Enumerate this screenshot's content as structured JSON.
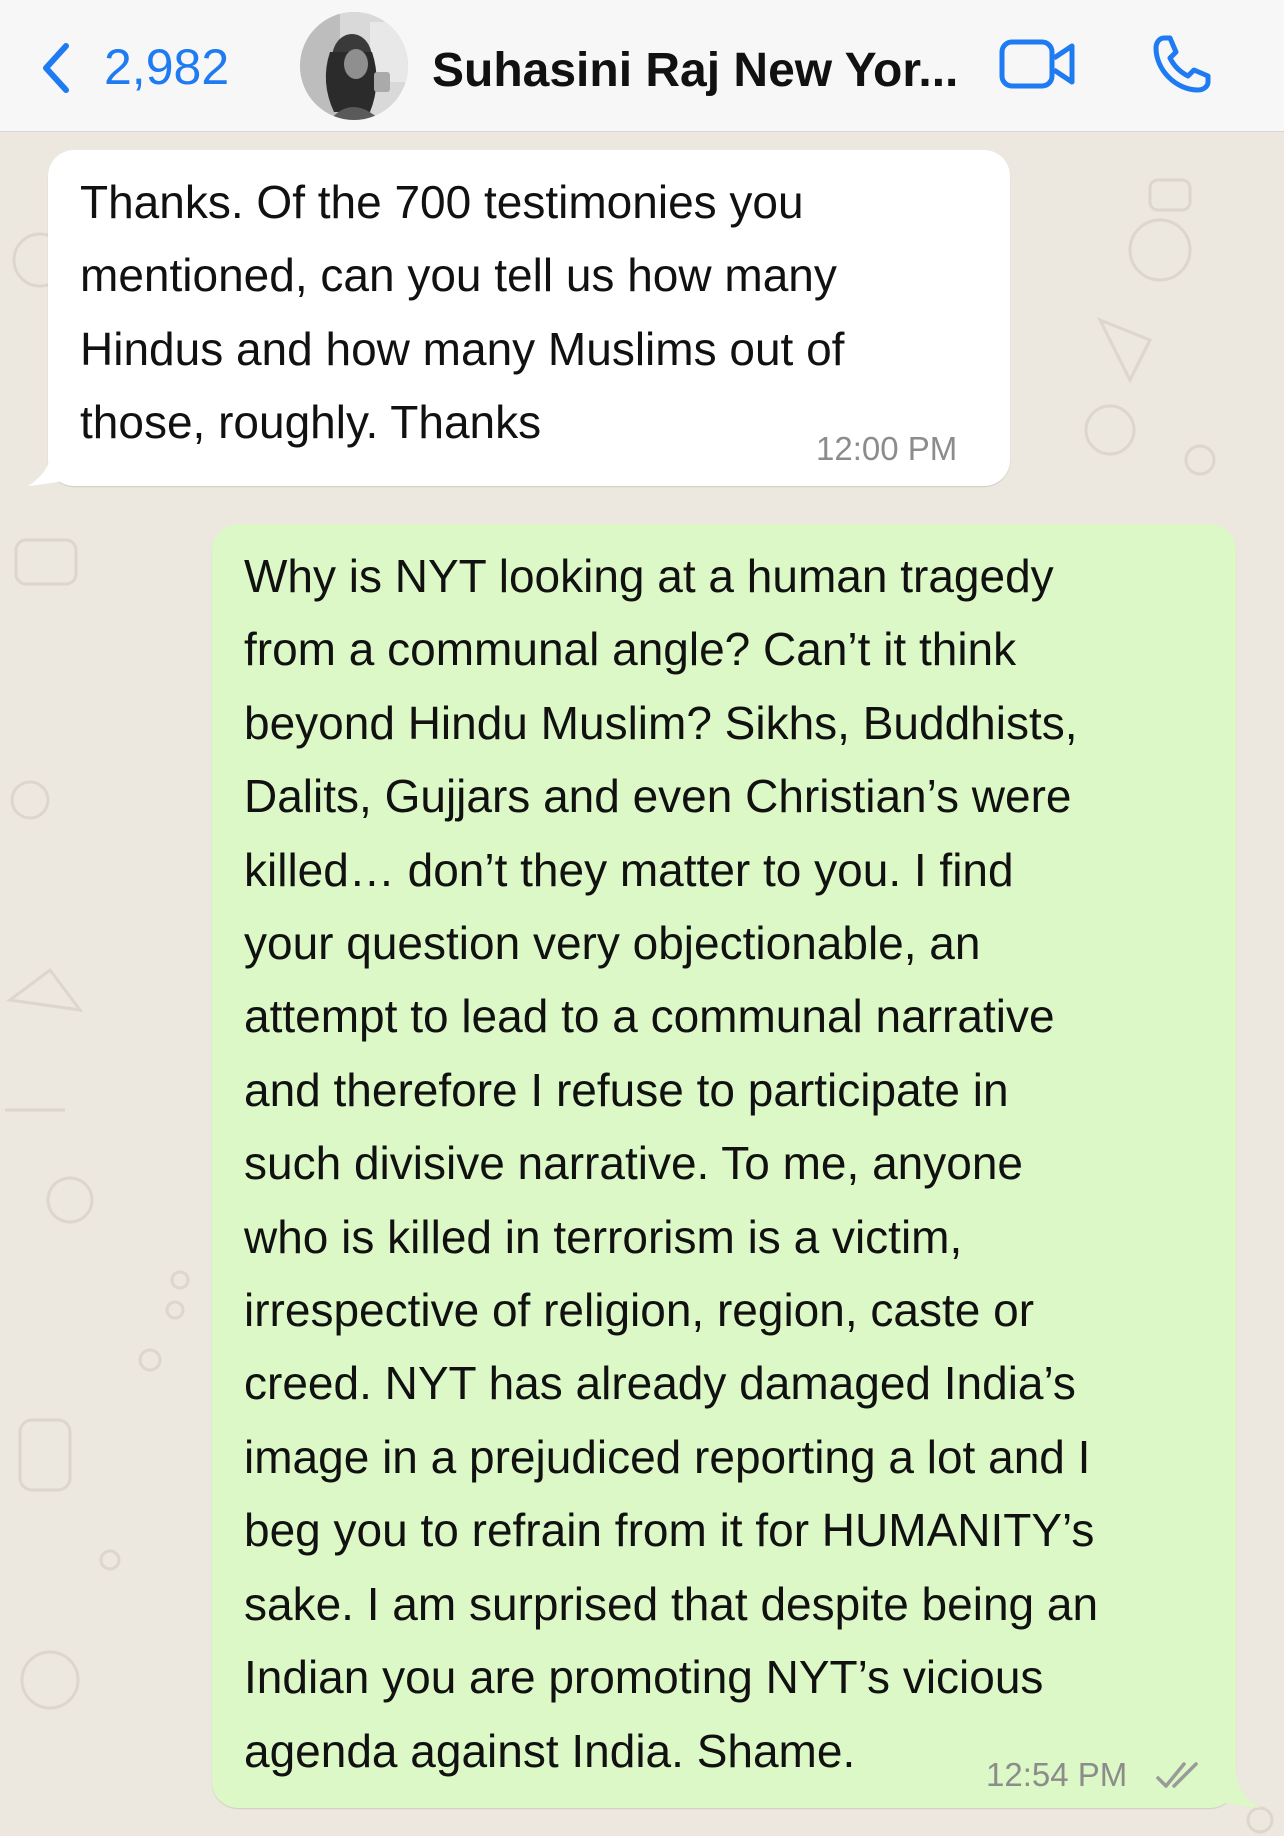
{
  "header": {
    "back_count": "2,982",
    "contact_name": "Suhasini Raj New Yor...",
    "accent_color": "#1f7bf2"
  },
  "messages": [
    {
      "direction": "incoming",
      "text": "Thanks. Of the 700 testimonies you\nmentioned, can you tell us how many\nHindus and how many Muslims out of\nthose, roughly. Thanks",
      "time": "12:00 PM",
      "bubble_color": "#ffffff"
    },
    {
      "direction": "outgoing",
      "text": "Why is NYT looking at a human tragedy\nfrom a communal angle? Can’t it think\nbeyond Hindu Muslim? Sikhs, Buddhists,\nDalits, Gujjars and even Christian’s were\nkilled… don’t they matter to you. I find\nyour question very objectionable, an\nattempt to lead to a communal narrative\nand therefore I refuse to participate in\nsuch divisive narrative. To me, anyone\nwho is killed in terrorism is a victim,\nirrespective of religion, region, caste or\ncreed. NYT has already damaged India’s\nimage in a prejudiced reporting a lot and I\nbeg you to refrain from it for HUMANITY’s\nsake. I am surprised that despite being an\nIndian you are promoting NYT’s vicious\nagenda against India. Shame.",
      "time": "12:54 PM",
      "status": "read",
      "bubble_color": "#dcf8c6"
    }
  ],
  "icons": [
    "back-chevron-icon",
    "video-camera-icon",
    "phone-icon",
    "double-check-icon"
  ]
}
